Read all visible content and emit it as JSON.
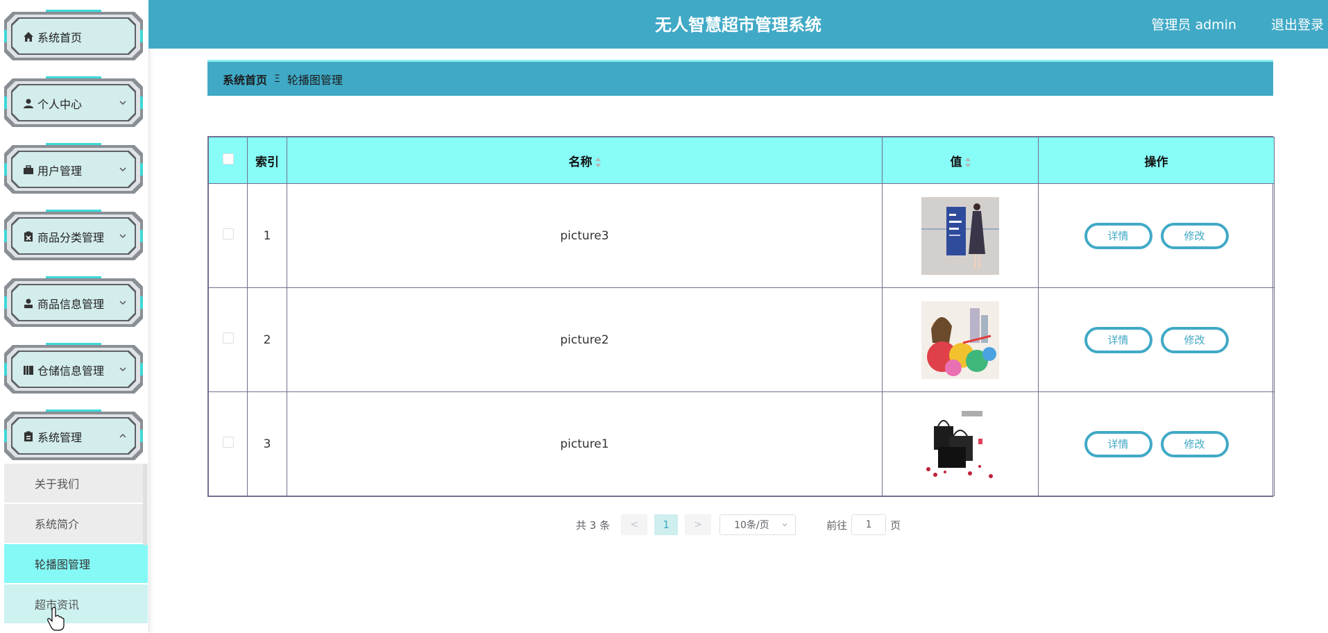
{
  "header": {
    "title": "无人智慧超市管理系统",
    "user": "管理员 admin",
    "logout": "退出登录"
  },
  "sidebar": {
    "items": [
      {
        "label": "系统首页",
        "icon": "home-icon"
      },
      {
        "label": "个人中心",
        "icon": "user-icon"
      },
      {
        "label": "用户管理",
        "icon": "briefcase-icon"
      },
      {
        "label": "商品分类管理",
        "icon": "clipboard-x-icon"
      },
      {
        "label": "商品信息管理",
        "icon": "person-icon"
      },
      {
        "label": "仓储信息管理",
        "icon": "books-icon"
      },
      {
        "label": "系统管理",
        "icon": "clipboard-icon"
      }
    ],
    "submenu": [
      {
        "label": "关于我们"
      },
      {
        "label": "系统简介"
      },
      {
        "label": "轮播图管理"
      },
      {
        "label": "超市资讯"
      }
    ]
  },
  "breadcrumb": {
    "home": "系统首页",
    "separator": "Ξ",
    "current": "轮播图管理"
  },
  "table": {
    "headers": {
      "index": "索引",
      "name": "名称",
      "value": "值",
      "actions": "操作"
    },
    "rows": [
      {
        "index": "1",
        "name": "picture3",
        "image": "fashion-photo"
      },
      {
        "index": "2",
        "name": "picture2",
        "image": "colorful-illustration"
      },
      {
        "index": "3",
        "name": "picture1",
        "image": "bags-photo"
      }
    ],
    "detail_label": "详情",
    "edit_label": "修改"
  },
  "pager": {
    "total": "共 3 条",
    "prev": "<",
    "next": ">",
    "current": "1",
    "size": "10条/页",
    "goto": "前往",
    "goto_value": "1",
    "page": "页"
  },
  "colors": {
    "accent": "#40a9c6",
    "header_cell": "#88fcf7",
    "active_submenu": "#85f9f5"
  }
}
